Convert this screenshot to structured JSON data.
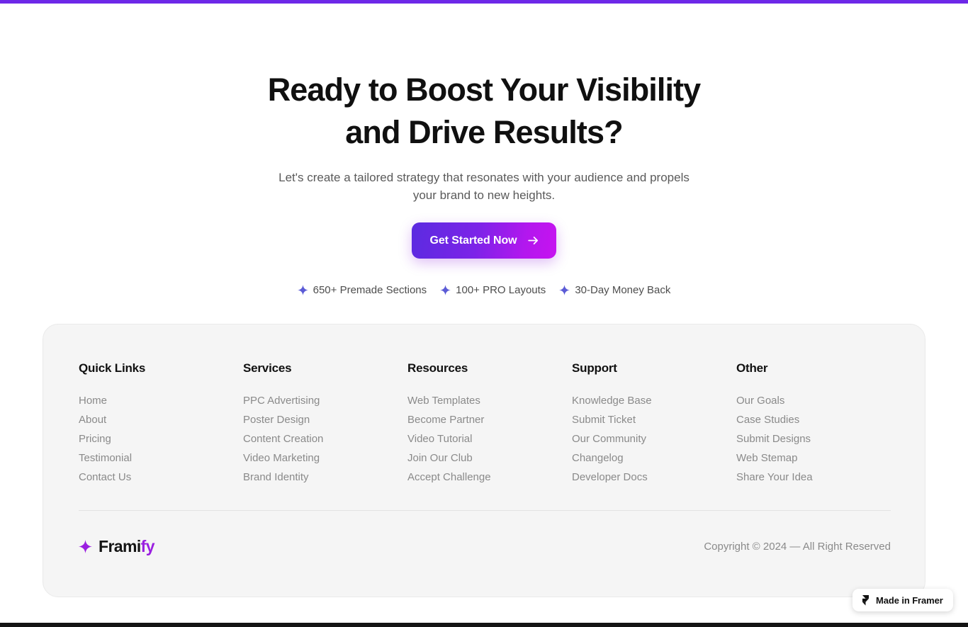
{
  "theme": {
    "accent_bar": "#6D28E8",
    "cta_gradient_start": "#5B2BE0",
    "cta_gradient_end": "#C713F0",
    "spark_color": "#5B5BD6",
    "brand_accent": "#9A1FE0",
    "card_background": "#F5F5F5"
  },
  "hero": {
    "title_line1": "Ready to Boost Your Visibility",
    "title_line2": "and Drive Results?",
    "subtitle_line1": "Let's create a tailored strategy that resonates with your audience and propels",
    "subtitle_line2": "your brand to new heights.",
    "cta_label": "Get Started Now",
    "cta_icon": "arrow-right-icon",
    "badges": [
      {
        "icon": "sparkle-icon",
        "label": "650+ Premade Sections"
      },
      {
        "icon": "sparkle-icon",
        "label": "100+ PRO Layouts"
      },
      {
        "icon": "sparkle-icon",
        "label": "30-Day Money Back"
      }
    ]
  },
  "footer": {
    "columns": [
      {
        "title": "Quick Links",
        "links": [
          "Home",
          "About",
          "Pricing",
          "Testimonial",
          "Contact Us"
        ]
      },
      {
        "title": "Services",
        "links": [
          "PPC Advertising",
          "Poster Design",
          "Content Creation",
          "Video Marketing",
          "Brand Identity"
        ]
      },
      {
        "title": "Resources",
        "links": [
          "Web Templates",
          "Become Partner",
          "Video Tutorial",
          "Join Our Club",
          "Accept Challenge"
        ]
      },
      {
        "title": "Support",
        "links": [
          "Knowledge Base",
          "Submit Ticket",
          "Our Community",
          "Changelog",
          "Developer Docs"
        ]
      },
      {
        "title": "Other",
        "links": [
          "Our Goals",
          "Case Studies",
          "Submit Designs",
          "Web Stemap",
          "Share Your Idea"
        ]
      }
    ],
    "brand": {
      "icon": "sparkle-icon",
      "name_primary": "Frami",
      "name_accent": "fy"
    },
    "copyright": "Copyright © 2024 — All Right Reserved"
  },
  "framer_badge": {
    "icon": "framer-logo-icon",
    "label": "Made in Framer"
  }
}
